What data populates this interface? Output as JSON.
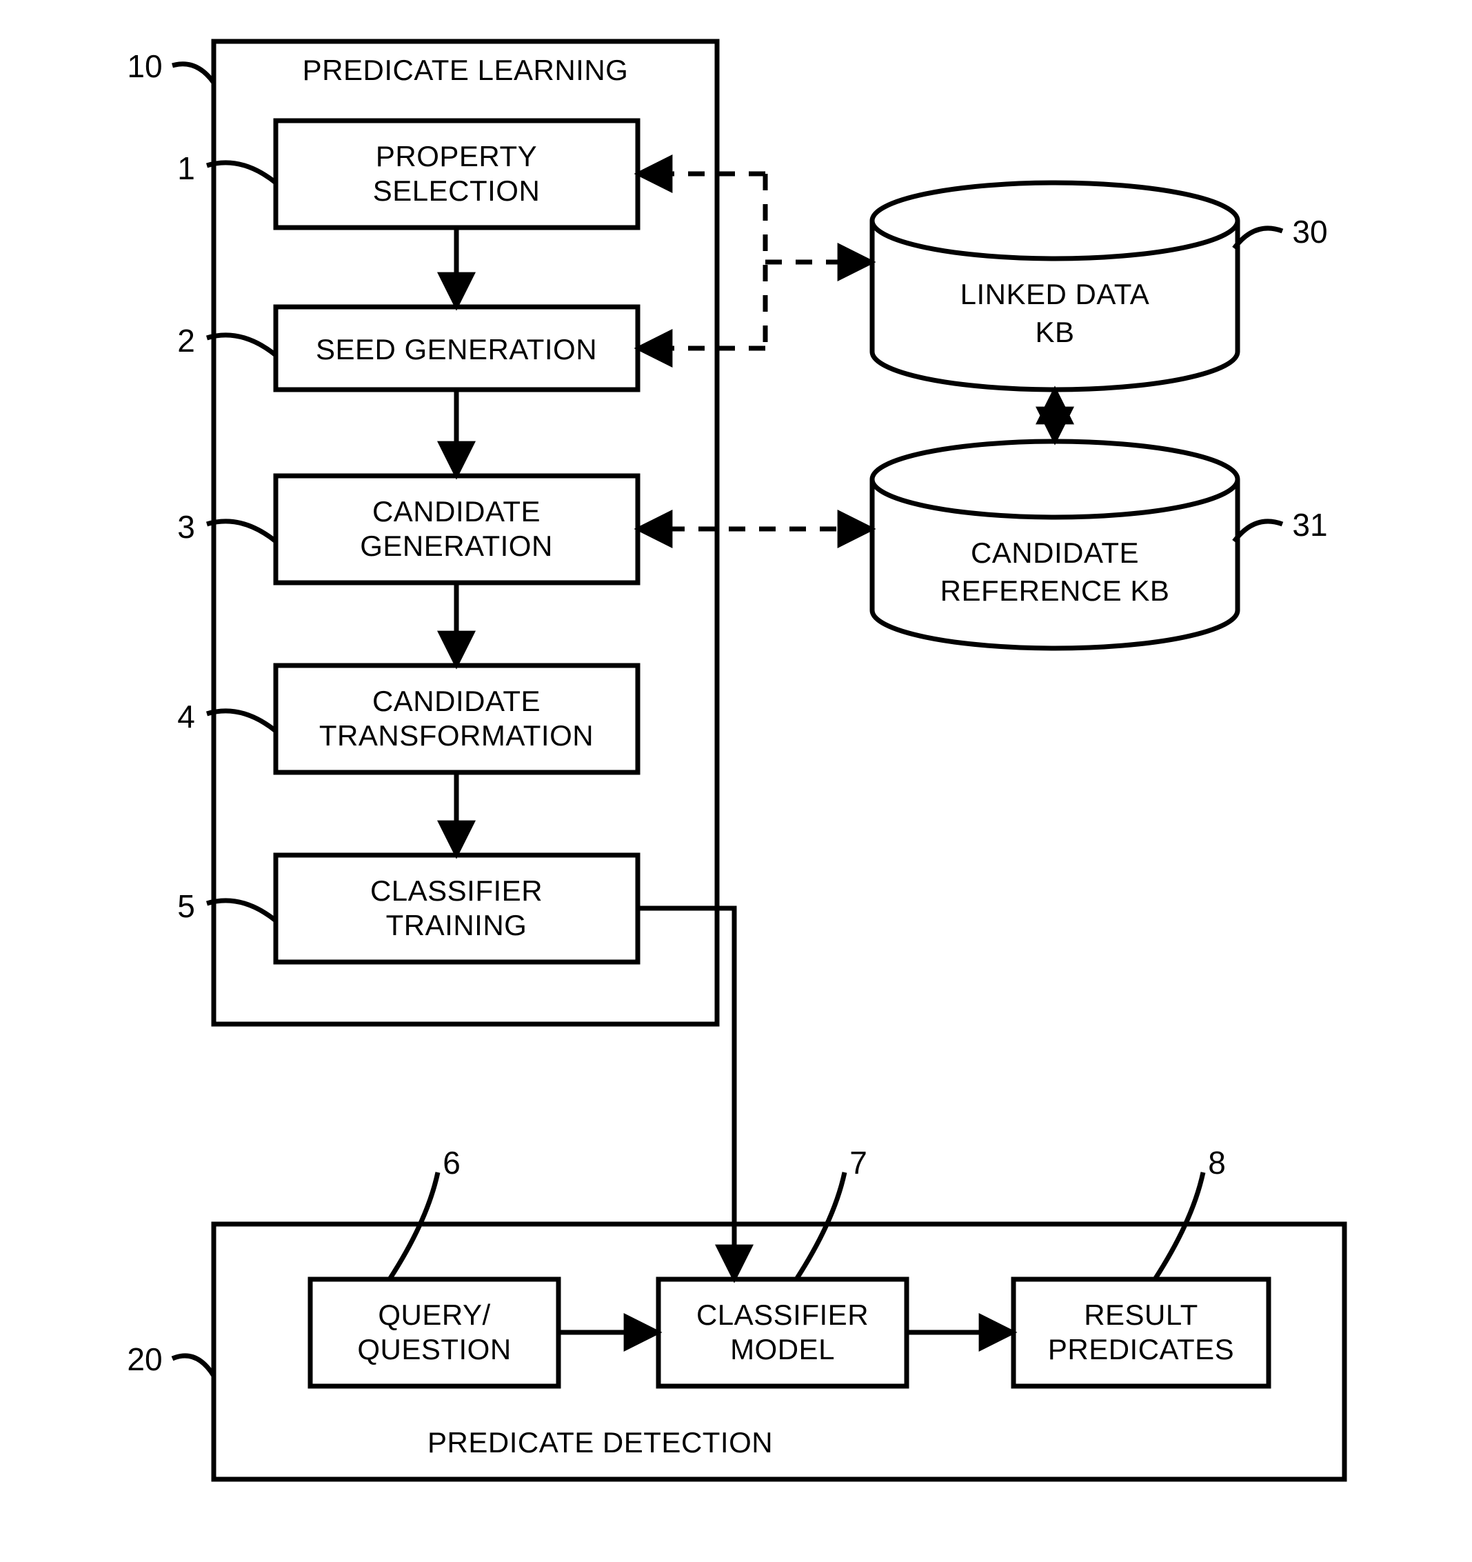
{
  "learning": {
    "title": "PREDICATE LEARNING",
    "boxes": {
      "b1": {
        "l1": "PROPERTY",
        "l2": "SELECTION"
      },
      "b2": {
        "l1": "SEED GENERATION"
      },
      "b3": {
        "l1": "CANDIDATE",
        "l2": "GENERATION"
      },
      "b4": {
        "l1": "CANDIDATE",
        "l2": "TRANSFORMATION"
      },
      "b5": {
        "l1": "CLASSIFIER",
        "l2": "TRAINING"
      }
    }
  },
  "detection": {
    "title": "PREDICATE DETECTION",
    "boxes": {
      "b6": {
        "l1": "QUERY/",
        "l2": "QUESTION"
      },
      "b7": {
        "l1": "CLASSIFIER",
        "l2": "MODEL"
      },
      "b8": {
        "l1": "RESULT",
        "l2": "PREDICATES"
      }
    }
  },
  "db": {
    "kb1": {
      "l1": "LINKED DATA",
      "l2": "KB"
    },
    "kb2": {
      "l1": "CANDIDATE",
      "l2": "REFERENCE KB"
    }
  },
  "refs": {
    "n1": "1",
    "n2": "2",
    "n3": "3",
    "n4": "4",
    "n5": "5",
    "n6": "6",
    "n7": "7",
    "n8": "8",
    "n10": "10",
    "n20": "20",
    "n30": "30",
    "n31": "31"
  }
}
